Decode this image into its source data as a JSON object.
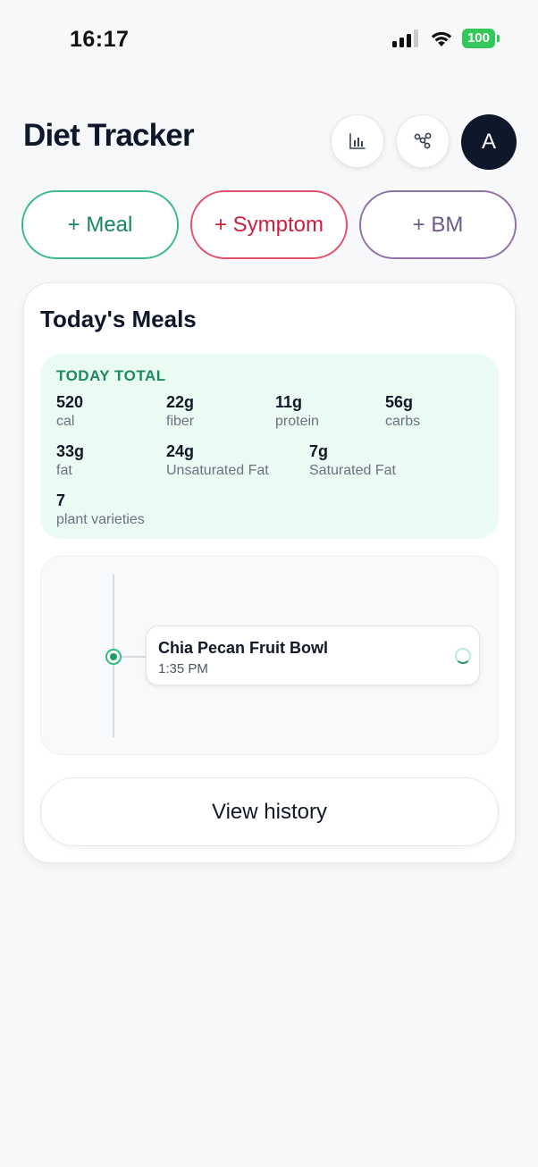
{
  "status_bar": {
    "time": "16:17",
    "battery": "100"
  },
  "header": {
    "title": "Diet Tracker",
    "avatar_initial": "A",
    "icons": {
      "chart": "bar-chart-icon",
      "network": "network-icon"
    }
  },
  "quick_add": {
    "meal": "+ Meal",
    "symptom": "+ Symptom",
    "bm": "+ BM"
  },
  "meals_card": {
    "title": "Today's Meals",
    "totals": {
      "label": "TODAY TOTAL",
      "stats": [
        {
          "value": "520",
          "unit": "cal"
        },
        {
          "value": "22g",
          "unit": "fiber"
        },
        {
          "value": "11g",
          "unit": "protein"
        },
        {
          "value": "56g",
          "unit": "carbs"
        },
        {
          "value": "33g",
          "unit": "fat"
        },
        {
          "value": "24g",
          "unit": "Unsaturated Fat"
        },
        {
          "value": "7g",
          "unit": "Saturated Fat"
        },
        {
          "value": "7",
          "unit": "plant varieties"
        }
      ]
    },
    "timeline": [
      {
        "name": "Chia Pecan Fruit Bowl",
        "time": "1:35 PM"
      }
    ],
    "view_history": "View history"
  },
  "colors": {
    "meal": "#3bb98a",
    "symptom": "#e0536d",
    "bm": "#8f73a8",
    "totals_bg": "#e9fbf2",
    "avatar_bg": "#0f172a"
  }
}
